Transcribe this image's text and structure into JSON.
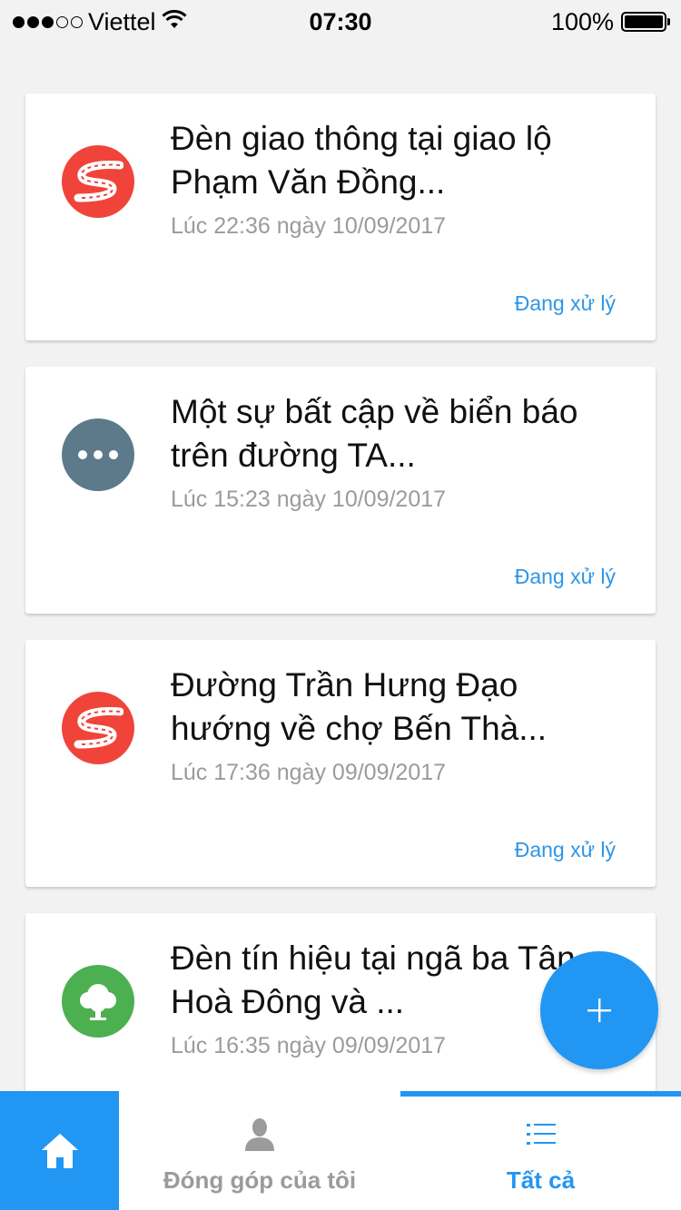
{
  "status_bar": {
    "carrier": "Viettel",
    "time": "07:30",
    "battery": "100%",
    "signal_icon": "signal-dots-icon",
    "wifi_icon": "wifi-icon",
    "battery_icon": "battery-icon"
  },
  "feed": [
    {
      "title": "Đèn giao thông tại giao lộ\nPhạm Văn Đồng...",
      "time": "Lúc 22:36 ngày 10/09/2017",
      "status": "Đang xử lý",
      "icon": "road-icon",
      "icon_color": "#f0443a"
    },
    {
      "title": "Một sự bất cập về biển báo\ntrên đường TA...",
      "time": "Lúc 15:23 ngày 10/09/2017",
      "status": "Đang xử lý",
      "icon": "more-icon",
      "icon_color": "#5d7a8a"
    },
    {
      "title": "Đường Trần Hưng Đạo\nhướng về chợ Bến Thà...",
      "time": "Lúc 17:36 ngày 09/09/2017",
      "status": "Đang xử lý",
      "icon": "road-icon",
      "icon_color": "#f0443a"
    },
    {
      "title": "Đèn tín hiệu tại ngã ba Tân\nHoà Đông và ...",
      "time": "Lúc 16:35 ngày 09/09/2017",
      "status": "",
      "icon": "tree-icon",
      "icon_color": "#4caf50"
    }
  ],
  "fab": {
    "icon": "plus-icon",
    "color": "#2196f3"
  },
  "bottom_nav": {
    "home_icon": "home-icon",
    "my_contributions": {
      "label": "Đóng góp của tôi",
      "icon": "person-icon"
    },
    "all": {
      "label": "Tất cả",
      "icon": "list-icon",
      "active": true
    }
  },
  "colors": {
    "accent": "#2196f3",
    "status_text": "#2d96e8",
    "muted": "#9b9b9b"
  }
}
